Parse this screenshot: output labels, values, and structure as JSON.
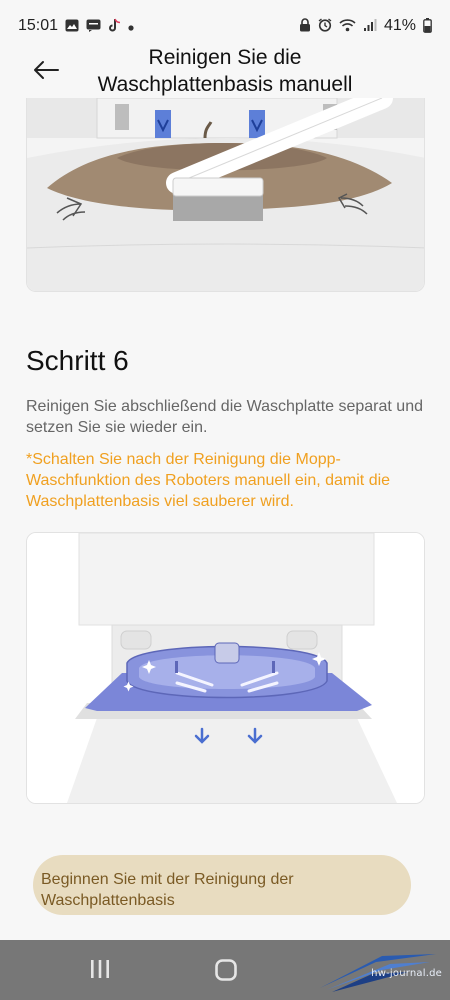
{
  "status_bar": {
    "time": "15:01",
    "battery": "41%",
    "left_icons": [
      "image-icon",
      "message-icon",
      "tiktok-icon",
      "dot-icon"
    ],
    "right_icons": [
      "lock-icon",
      "alarm-icon",
      "wifi-icon",
      "signal-icon",
      "battery-icon"
    ]
  },
  "header": {
    "title": "Reinigen Sie die Waschplattenbasis manuell",
    "back_icon": "arrow-left-icon"
  },
  "step": {
    "title": "Schritt 6",
    "description": "Reinigen Sie abschließend die Waschplatte separat und setzen Sie sie wieder ein.",
    "note": "*Schalten Sie nach der Reinigung die Mopp-Waschfunktion des Roboters manuell ein, damit die Waschplattenbasis viel sauberer wird."
  },
  "action": {
    "start_label": "Beginnen Sie mit der Reinigung der Waschplattenbasis"
  },
  "nav_bar": {
    "icons": [
      "recents-icon",
      "home-icon"
    ]
  },
  "watermark": {
    "text": "hw-journal.de"
  },
  "colors": {
    "accent_orange": "#f0a020",
    "button_bg": "#e8dcc0",
    "button_text": "#7a5a24",
    "illustration_blue": "#7b86d8",
    "nav_bar": "#777777"
  }
}
